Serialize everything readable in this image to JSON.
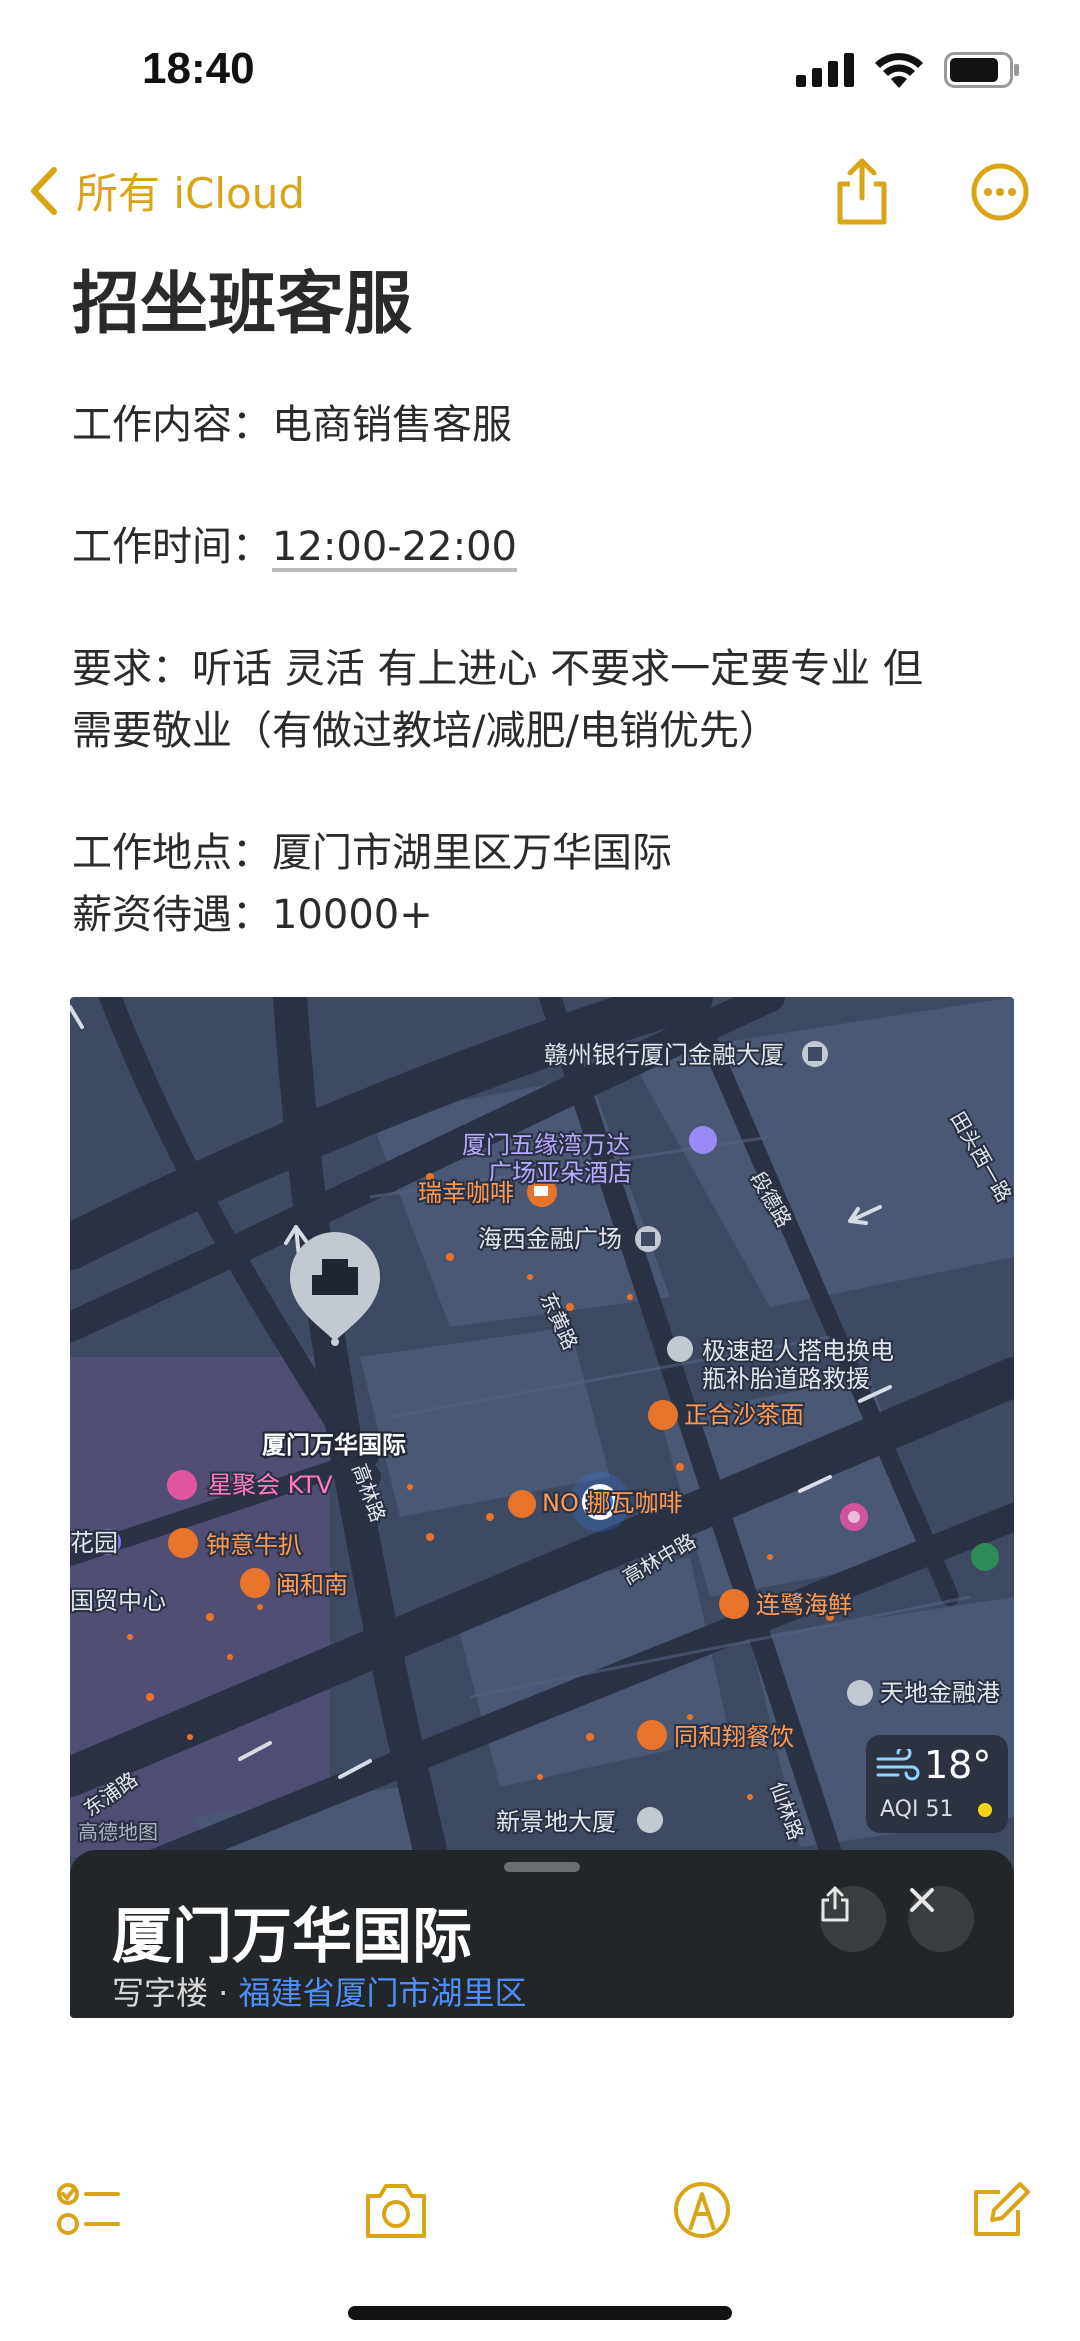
{
  "status": {
    "time": "18:40"
  },
  "nav": {
    "back_label": "所有 iCloud"
  },
  "note": {
    "title": "招坐班客服",
    "content_line": "工作内容：电商销售客服",
    "time_prefix": "工作时间：",
    "time_value": "12:00-22:00",
    "requirements_1": "要求：听话 灵活 有上进心 不要求一定要专业 但",
    "requirements_2": "需要敬业（有做过教培/减肥/电销优先）",
    "location_line": "工作地点：厦门市湖里区万华国际",
    "salary_line": "薪资待遇：10000+"
  },
  "map": {
    "labels": {
      "ganzhou_bank": "赣州银行厦门金融大厦",
      "xiamen_wuyuan_1": "厦门五缘湾万达",
      "xiamen_wuyuan_2": "广场亚朵酒店",
      "luckin": "瑞幸咖啡",
      "haixi": "海西金融广场",
      "dongdu_road": "东黄路",
      "duande_road": "段德路",
      "jisu_1": "极速超人搭电换电",
      "jisu_2": "瓶补胎道路救援",
      "zhenghe": "正合沙茶面",
      "wanhua_pin": "厦门万华国际",
      "xingju": "星聚会 KTV",
      "gaolin_road": "高林路",
      "nowa": "NO 挪瓦咖啡",
      "gaolin_middle": "高林中路",
      "yuan": "花园",
      "zhongyi": "钟意牛扒",
      "minhenan": "闽和南",
      "guomao": "国贸中心",
      "lianjiang": "连鹭海鲜",
      "tiandi": "天地金融港",
      "tonghexiang": "同和翔餐饮",
      "xianlin_road": "仙林路",
      "xinjing": "新景地大厦",
      "map_watermark": "高德地图",
      "tou_road": "田头西一路",
      "bottom_road": "东浦路"
    },
    "weather": {
      "temp": "18°",
      "aqi": "AQI 51"
    },
    "place": {
      "name": "厦门万华国际",
      "category": "写字楼 · ",
      "address": "福建省厦门市湖里区"
    }
  },
  "colors": {
    "accent": "#d9a416",
    "map_bg": "#3e4a62",
    "poi_orange": "#e8742c",
    "user_dot": "#3478f6"
  }
}
